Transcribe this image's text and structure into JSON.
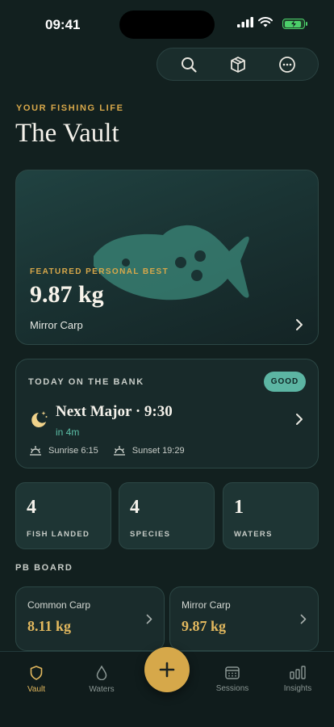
{
  "status_bar": {
    "time": "09:41"
  },
  "header": {
    "eyebrow": "YOUR FISHING LIFE",
    "title": "The Vault",
    "actions": [
      "search-icon",
      "box-icon",
      "more-icon"
    ]
  },
  "featured": {
    "label": "FEATURED PERSONAL BEST",
    "weight": "9.87 kg",
    "species": "Mirror Carp"
  },
  "today": {
    "label": "TODAY ON THE BANK",
    "badge": "GOOD",
    "next_major": "Next Major · 9:30",
    "countdown": "in 4m",
    "sunrise": "Sunrise 6:15",
    "sunset": "Sunset 19:29"
  },
  "stats": [
    {
      "value": "4",
      "label": "FISH LANDED"
    },
    {
      "value": "4",
      "label": "SPECIES"
    },
    {
      "value": "1",
      "label": "WATERS"
    }
  ],
  "pb_board": {
    "title": "PB BOARD",
    "items": [
      {
        "name": "Common Carp",
        "weight": "8.11 kg"
      },
      {
        "name": "Mirror Carp",
        "weight": "9.87 kg"
      }
    ]
  },
  "tabs": [
    {
      "label": "Vault",
      "active": true
    },
    {
      "label": "Waters",
      "active": false
    },
    {
      "label": "Sessions",
      "active": false
    },
    {
      "label": "Insights",
      "active": false
    }
  ],
  "colors": {
    "accent": "#d6a84a",
    "teal": "#5cb5a3",
    "background": "#12201f"
  }
}
